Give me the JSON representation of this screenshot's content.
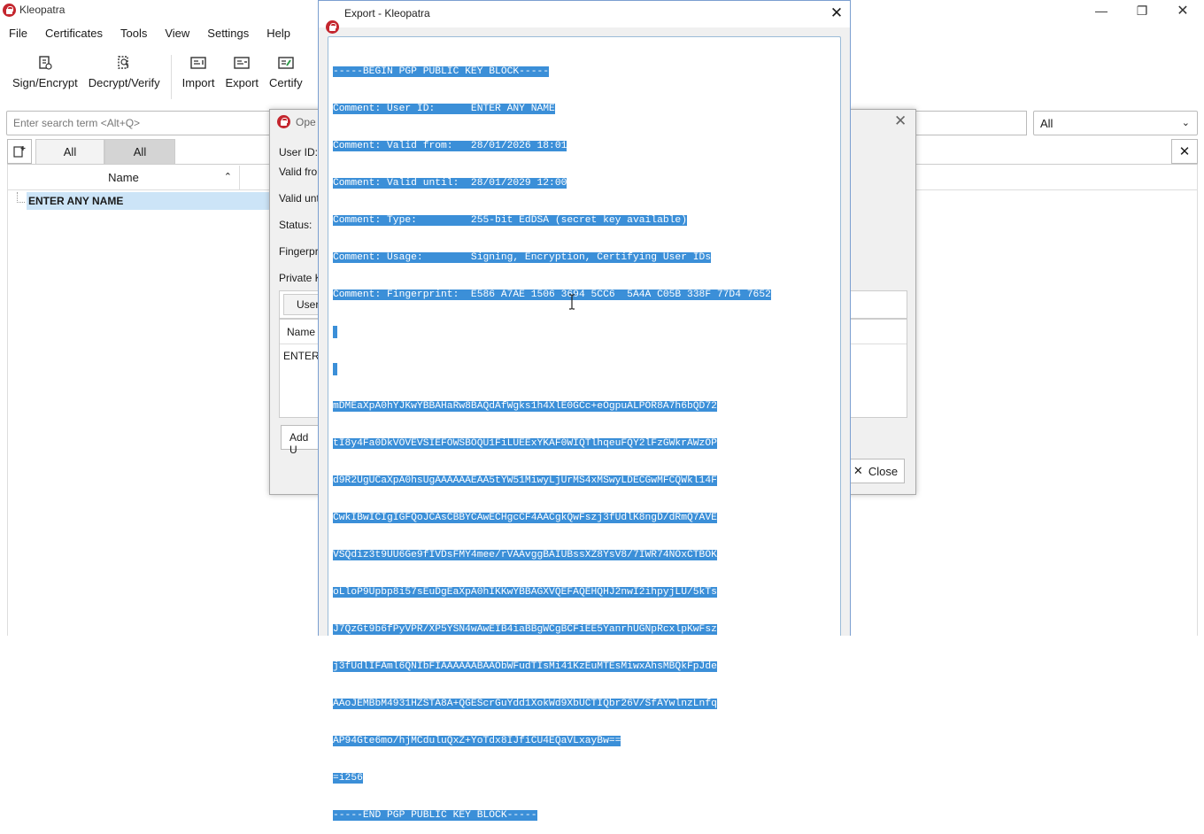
{
  "main": {
    "title": "Kleopatra",
    "menu": [
      "File",
      "Certificates",
      "Tools",
      "View",
      "Settings",
      "Help"
    ],
    "toolbar": {
      "sign_encrypt": "Sign/Encrypt",
      "decrypt_verify": "Decrypt/Verify",
      "import": "Import",
      "export": "Export",
      "certify": "Certify"
    },
    "search_placeholder": "Enter search term <Alt+Q>",
    "filter_value": "All",
    "tabs": [
      "All",
      "All"
    ],
    "list": {
      "column_name": "Name",
      "rows": [
        "ENTER ANY NAME"
      ]
    }
  },
  "details_dialog": {
    "title": "Ope",
    "fields": {
      "user_id": "User ID:",
      "valid_from": "Valid fro",
      "valid_until": "Valid unt",
      "status": "Status:",
      "fingerprint": "Fingerpri",
      "private_key": "Private K"
    },
    "tab_label": "User",
    "table_header": "Name",
    "table_cell": "ENTER",
    "add_button": "Add U",
    "close_button": "Close"
  },
  "export_dialog": {
    "title": "Export - Kleopatra",
    "key_lines": [
      "-----BEGIN PGP PUBLIC KEY BLOCK-----",
      "Comment: User ID:      ENTER ANY NAME",
      "Comment: Valid from:   28/01/2026 18:01",
      "Comment: Valid until:  28/01/2029 12:00",
      "Comment: Type:         255-bit EdDSA (secret key available)",
      "Comment: Usage:        Signing, Encryption, Certifying User IDs",
      "Comment: Fingerprint:  E586 A7AE 1506 3694 5CC6  5A4A C05B 338F 77D4 7652",
      "",
      "mDMEaXpA0hYJKwYBBAHaRw8BAQdAfWgks1h4XlE0GCc+eOgpuALPOR8A7h6bQD72",
      "tI8y4Fa0DkVOVEVSIEFOWSBOQU1FiLUEExYKAF0WIQTlhqeuFQY2lFzGWkrAWzOP",
      "d9R2UgUCaXpA0hsUgAAAAAAEAA5tYW51MiwyLjUrMS4xMSwyLDECGwMFCQWkl14F",
      "CwkIBwICIgIGFQoJCAsCBBYCAwECHgcCF4AACgkQwFszj3fUdlK8ngD/dRmQ7AVE",
      "VSQdiz3t9UU6Ge9fIVDsFMY4mee/rVAAvggBAIUBssXZ8YsV8/7IWR74NOxCTBOK",
      "oLloP9Upbp8i57sEuDgEaXpA0hIKKwYBBAGXVQEFAQEHQHJ2nwI2ihpyjLU/5kTs",
      "J7QzGt9b6fPyVPR/XP5YSN4wAwEIB4iaBBgWCgBCFiEE5YanrhUGNpRcxlpKwFsz",
      "j3fUdlIFAml6QNIbFIAAAAAABAAObWFudTIsMi41KzEuMTEsMiwxAhsMBQkFpJde",
      "AAoJEMBbM4931HZSTA8A+QGEScrGuYdd1XokWd9XbUCTIQbr26V/SfAYwlnzLnfq",
      "AP94Gte6mo/hjMCduluQxZ+YoTdx8IJfiCU4EQaVLxayBw==",
      "=i256",
      "-----END PGP PUBLIC KEY BLOCK-----"
    ]
  },
  "colors": {
    "selection": "#3b8fd8",
    "row_highlight": "#cce4f7",
    "brand": "#c4262e"
  }
}
